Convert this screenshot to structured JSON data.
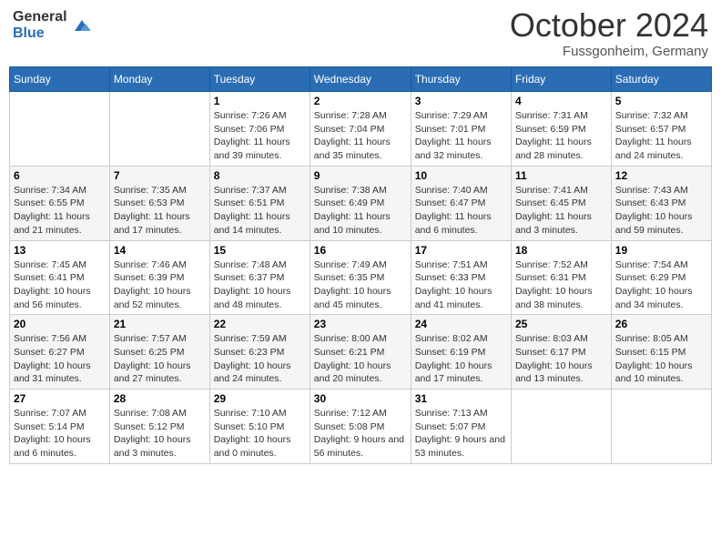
{
  "header": {
    "logo_general": "General",
    "logo_blue": "Blue",
    "month_title": "October 2024",
    "location": "Fussgonheim, Germany"
  },
  "days_of_week": [
    "Sunday",
    "Monday",
    "Tuesday",
    "Wednesday",
    "Thursday",
    "Friday",
    "Saturday"
  ],
  "weeks": [
    [
      {
        "day": "",
        "sunrise": "",
        "sunset": "",
        "daylight": ""
      },
      {
        "day": "",
        "sunrise": "",
        "sunset": "",
        "daylight": ""
      },
      {
        "day": "1",
        "sunrise": "Sunrise: 7:26 AM",
        "sunset": "Sunset: 7:06 PM",
        "daylight": "Daylight: 11 hours and 39 minutes."
      },
      {
        "day": "2",
        "sunrise": "Sunrise: 7:28 AM",
        "sunset": "Sunset: 7:04 PM",
        "daylight": "Daylight: 11 hours and 35 minutes."
      },
      {
        "day": "3",
        "sunrise": "Sunrise: 7:29 AM",
        "sunset": "Sunset: 7:01 PM",
        "daylight": "Daylight: 11 hours and 32 minutes."
      },
      {
        "day": "4",
        "sunrise": "Sunrise: 7:31 AM",
        "sunset": "Sunset: 6:59 PM",
        "daylight": "Daylight: 11 hours and 28 minutes."
      },
      {
        "day": "5",
        "sunrise": "Sunrise: 7:32 AM",
        "sunset": "Sunset: 6:57 PM",
        "daylight": "Daylight: 11 hours and 24 minutes."
      }
    ],
    [
      {
        "day": "6",
        "sunrise": "Sunrise: 7:34 AM",
        "sunset": "Sunset: 6:55 PM",
        "daylight": "Daylight: 11 hours and 21 minutes."
      },
      {
        "day": "7",
        "sunrise": "Sunrise: 7:35 AM",
        "sunset": "Sunset: 6:53 PM",
        "daylight": "Daylight: 11 hours and 17 minutes."
      },
      {
        "day": "8",
        "sunrise": "Sunrise: 7:37 AM",
        "sunset": "Sunset: 6:51 PM",
        "daylight": "Daylight: 11 hours and 14 minutes."
      },
      {
        "day": "9",
        "sunrise": "Sunrise: 7:38 AM",
        "sunset": "Sunset: 6:49 PM",
        "daylight": "Daylight: 11 hours and 10 minutes."
      },
      {
        "day": "10",
        "sunrise": "Sunrise: 7:40 AM",
        "sunset": "Sunset: 6:47 PM",
        "daylight": "Daylight: 11 hours and 6 minutes."
      },
      {
        "day": "11",
        "sunrise": "Sunrise: 7:41 AM",
        "sunset": "Sunset: 6:45 PM",
        "daylight": "Daylight: 11 hours and 3 minutes."
      },
      {
        "day": "12",
        "sunrise": "Sunrise: 7:43 AM",
        "sunset": "Sunset: 6:43 PM",
        "daylight": "Daylight: 10 hours and 59 minutes."
      }
    ],
    [
      {
        "day": "13",
        "sunrise": "Sunrise: 7:45 AM",
        "sunset": "Sunset: 6:41 PM",
        "daylight": "Daylight: 10 hours and 56 minutes."
      },
      {
        "day": "14",
        "sunrise": "Sunrise: 7:46 AM",
        "sunset": "Sunset: 6:39 PM",
        "daylight": "Daylight: 10 hours and 52 minutes."
      },
      {
        "day": "15",
        "sunrise": "Sunrise: 7:48 AM",
        "sunset": "Sunset: 6:37 PM",
        "daylight": "Daylight: 10 hours and 48 minutes."
      },
      {
        "day": "16",
        "sunrise": "Sunrise: 7:49 AM",
        "sunset": "Sunset: 6:35 PM",
        "daylight": "Daylight: 10 hours and 45 minutes."
      },
      {
        "day": "17",
        "sunrise": "Sunrise: 7:51 AM",
        "sunset": "Sunset: 6:33 PM",
        "daylight": "Daylight: 10 hours and 41 minutes."
      },
      {
        "day": "18",
        "sunrise": "Sunrise: 7:52 AM",
        "sunset": "Sunset: 6:31 PM",
        "daylight": "Daylight: 10 hours and 38 minutes."
      },
      {
        "day": "19",
        "sunrise": "Sunrise: 7:54 AM",
        "sunset": "Sunset: 6:29 PM",
        "daylight": "Daylight: 10 hours and 34 minutes."
      }
    ],
    [
      {
        "day": "20",
        "sunrise": "Sunrise: 7:56 AM",
        "sunset": "Sunset: 6:27 PM",
        "daylight": "Daylight: 10 hours and 31 minutes."
      },
      {
        "day": "21",
        "sunrise": "Sunrise: 7:57 AM",
        "sunset": "Sunset: 6:25 PM",
        "daylight": "Daylight: 10 hours and 27 minutes."
      },
      {
        "day": "22",
        "sunrise": "Sunrise: 7:59 AM",
        "sunset": "Sunset: 6:23 PM",
        "daylight": "Daylight: 10 hours and 24 minutes."
      },
      {
        "day": "23",
        "sunrise": "Sunrise: 8:00 AM",
        "sunset": "Sunset: 6:21 PM",
        "daylight": "Daylight: 10 hours and 20 minutes."
      },
      {
        "day": "24",
        "sunrise": "Sunrise: 8:02 AM",
        "sunset": "Sunset: 6:19 PM",
        "daylight": "Daylight: 10 hours and 17 minutes."
      },
      {
        "day": "25",
        "sunrise": "Sunrise: 8:03 AM",
        "sunset": "Sunset: 6:17 PM",
        "daylight": "Daylight: 10 hours and 13 minutes."
      },
      {
        "day": "26",
        "sunrise": "Sunrise: 8:05 AM",
        "sunset": "Sunset: 6:15 PM",
        "daylight": "Daylight: 10 hours and 10 minutes."
      }
    ],
    [
      {
        "day": "27",
        "sunrise": "Sunrise: 7:07 AM",
        "sunset": "Sunset: 5:14 PM",
        "daylight": "Daylight: 10 hours and 6 minutes."
      },
      {
        "day": "28",
        "sunrise": "Sunrise: 7:08 AM",
        "sunset": "Sunset: 5:12 PM",
        "daylight": "Daylight: 10 hours and 3 minutes."
      },
      {
        "day": "29",
        "sunrise": "Sunrise: 7:10 AM",
        "sunset": "Sunset: 5:10 PM",
        "daylight": "Daylight: 10 hours and 0 minutes."
      },
      {
        "day": "30",
        "sunrise": "Sunrise: 7:12 AM",
        "sunset": "Sunset: 5:08 PM",
        "daylight": "Daylight: 9 hours and 56 minutes."
      },
      {
        "day": "31",
        "sunrise": "Sunrise: 7:13 AM",
        "sunset": "Sunset: 5:07 PM",
        "daylight": "Daylight: 9 hours and 53 minutes."
      },
      {
        "day": "",
        "sunrise": "",
        "sunset": "",
        "daylight": ""
      },
      {
        "day": "",
        "sunrise": "",
        "sunset": "",
        "daylight": ""
      }
    ]
  ]
}
